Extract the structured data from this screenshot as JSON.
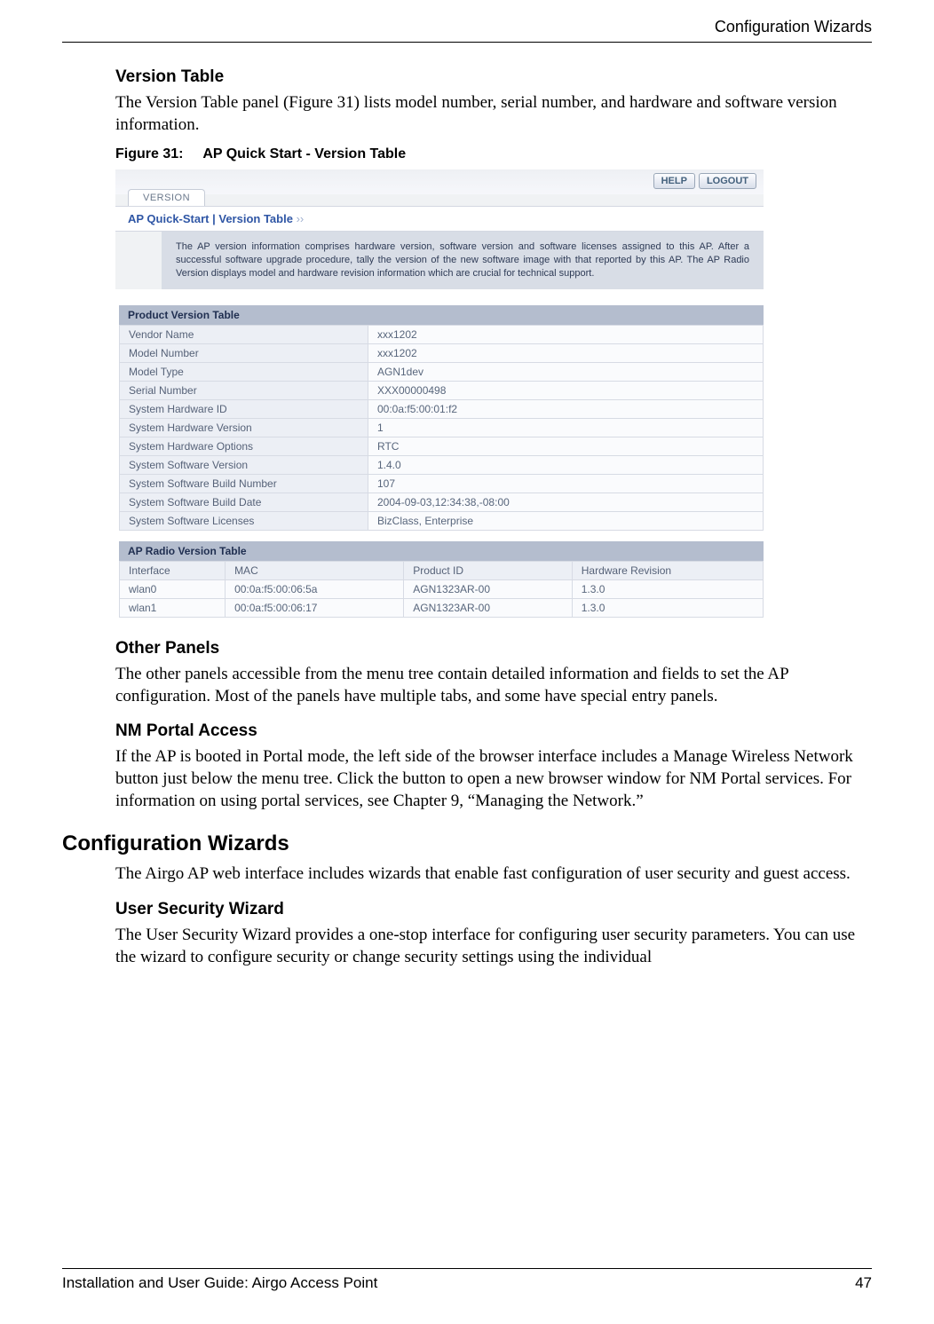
{
  "header": {
    "running": "Configuration Wizards"
  },
  "section1": {
    "title": "Version Table",
    "para": "The Version Table panel (Figure 31) lists model number, serial number, and hardware and software version information.",
    "fig_num": "Figure 31:",
    "fig_title": "AP Quick Start - Version Table"
  },
  "shot": {
    "help_label": "HELP",
    "logout_label": "LOGOUT",
    "tab_label": "VERSION",
    "breadcrumb": "AP Quick-Start | Version Table",
    "breadcrumb_arrows": "››",
    "description": "The AP version information comprises hardware version, software version and software licenses assigned to this AP. After a successful software upgrade procedure, tally the version of the new software image with that reported by this AP. The AP Radio Version displays model and hardware revision information which are crucial for technical support.",
    "pvt_title": "Product Version Table",
    "pvt_rows": [
      {
        "label": "Vendor Name",
        "value": "xxx1202"
      },
      {
        "label": "Model Number",
        "value": "xxx1202"
      },
      {
        "label": "Model Type",
        "value": "AGN1dev"
      },
      {
        "label": "Serial Number",
        "value": "XXX00000498"
      },
      {
        "label": "System Hardware ID",
        "value": "00:0a:f5:00:01:f2"
      },
      {
        "label": "System Hardware Version",
        "value": "1"
      },
      {
        "label": "System Hardware Options",
        "value": "RTC"
      },
      {
        "label": "System Software Version",
        "value": "1.4.0"
      },
      {
        "label": "System Software Build Number",
        "value": "107"
      },
      {
        "label": "System Software Build Date",
        "value": "2004-09-03,12:34:38,-08:00"
      },
      {
        "label": "System Software Licenses",
        "value": "BizClass, Enterprise"
      }
    ],
    "rvt_title": "AP Radio Version Table",
    "rvt_headers": [
      "Interface",
      "MAC",
      "Product ID",
      "Hardware Revision"
    ],
    "rvt_rows": [
      {
        "iface": "wlan0",
        "mac": "00:0a:f5:00:06:5a",
        "pid": "AGN1323AR-00",
        "hw": "1.3.0"
      },
      {
        "iface": "wlan1",
        "mac": "00:0a:f5:00:06:17",
        "pid": "AGN1323AR-00",
        "hw": "1.3.0"
      }
    ]
  },
  "section2": {
    "title": "Other Panels",
    "para": "The other panels accessible from the menu tree contain detailed information and fields to set the AP configuration. Most of the panels have multiple tabs, and some have special entry panels."
  },
  "section3": {
    "title": "NM Portal Access",
    "para": "If the AP is booted in Portal mode, the left side of the browser interface includes a Manage Wireless Network button just below the menu tree. Click the button to open a new browser window for NM Portal services. For information on using portal services, see Chapter 9,  “Managing the Network.”"
  },
  "section4": {
    "title": "Configuration Wizards",
    "para": "The Airgo AP web interface includes wizards that enable fast configuration of user security and guest access."
  },
  "section5": {
    "title": "User Security Wizard",
    "para": "The User Security Wizard provides a one-stop interface for configuring user security parameters. You can use the wizard to configure security or change security settings using the individual"
  },
  "footer": {
    "left": "Installation and User Guide: Airgo Access Point",
    "right": "47"
  }
}
